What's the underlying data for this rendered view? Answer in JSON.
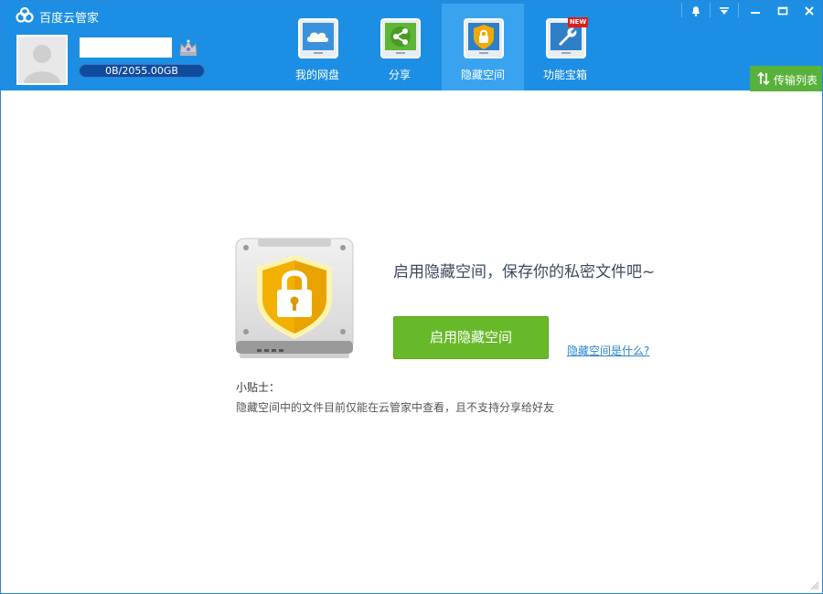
{
  "app": {
    "title": "百度云管家"
  },
  "user": {
    "quota_text": "0B/2055.00GB"
  },
  "nav": {
    "tabs": [
      {
        "label": "我的网盘",
        "icon": "cloud-drive-icon",
        "active": false
      },
      {
        "label": "分享",
        "icon": "share-icon",
        "active": false
      },
      {
        "label": "隐藏空间",
        "icon": "hidden-space-lock-icon",
        "active": true
      },
      {
        "label": "功能宝箱",
        "icon": "toolbox-wrench-icon",
        "active": false,
        "badge": "NEW"
      }
    ]
  },
  "window_controls": [
    "bell-icon",
    "menu-dropdown-icon",
    "minimize-icon",
    "maximize-icon",
    "close-icon"
  ],
  "transfer": {
    "label": "传输列表"
  },
  "main": {
    "headline": "启用隐藏空间，保存你的私密文件吧~",
    "enable_button": "启用隐藏空间",
    "help_link": "隐藏空间是什么?",
    "tips_title": "小贴士：",
    "tips_text": "隐藏空间中的文件目前仅能在云管家中查看，且不支持分享给好友"
  },
  "colors": {
    "header_bg": "#1c8fe4",
    "active_tab_bg": "#3aa3ef",
    "enable_button": "#68b92a",
    "transfer_button": "#58b13a",
    "link": "#2a85d0",
    "badge": "#e21c1c"
  }
}
